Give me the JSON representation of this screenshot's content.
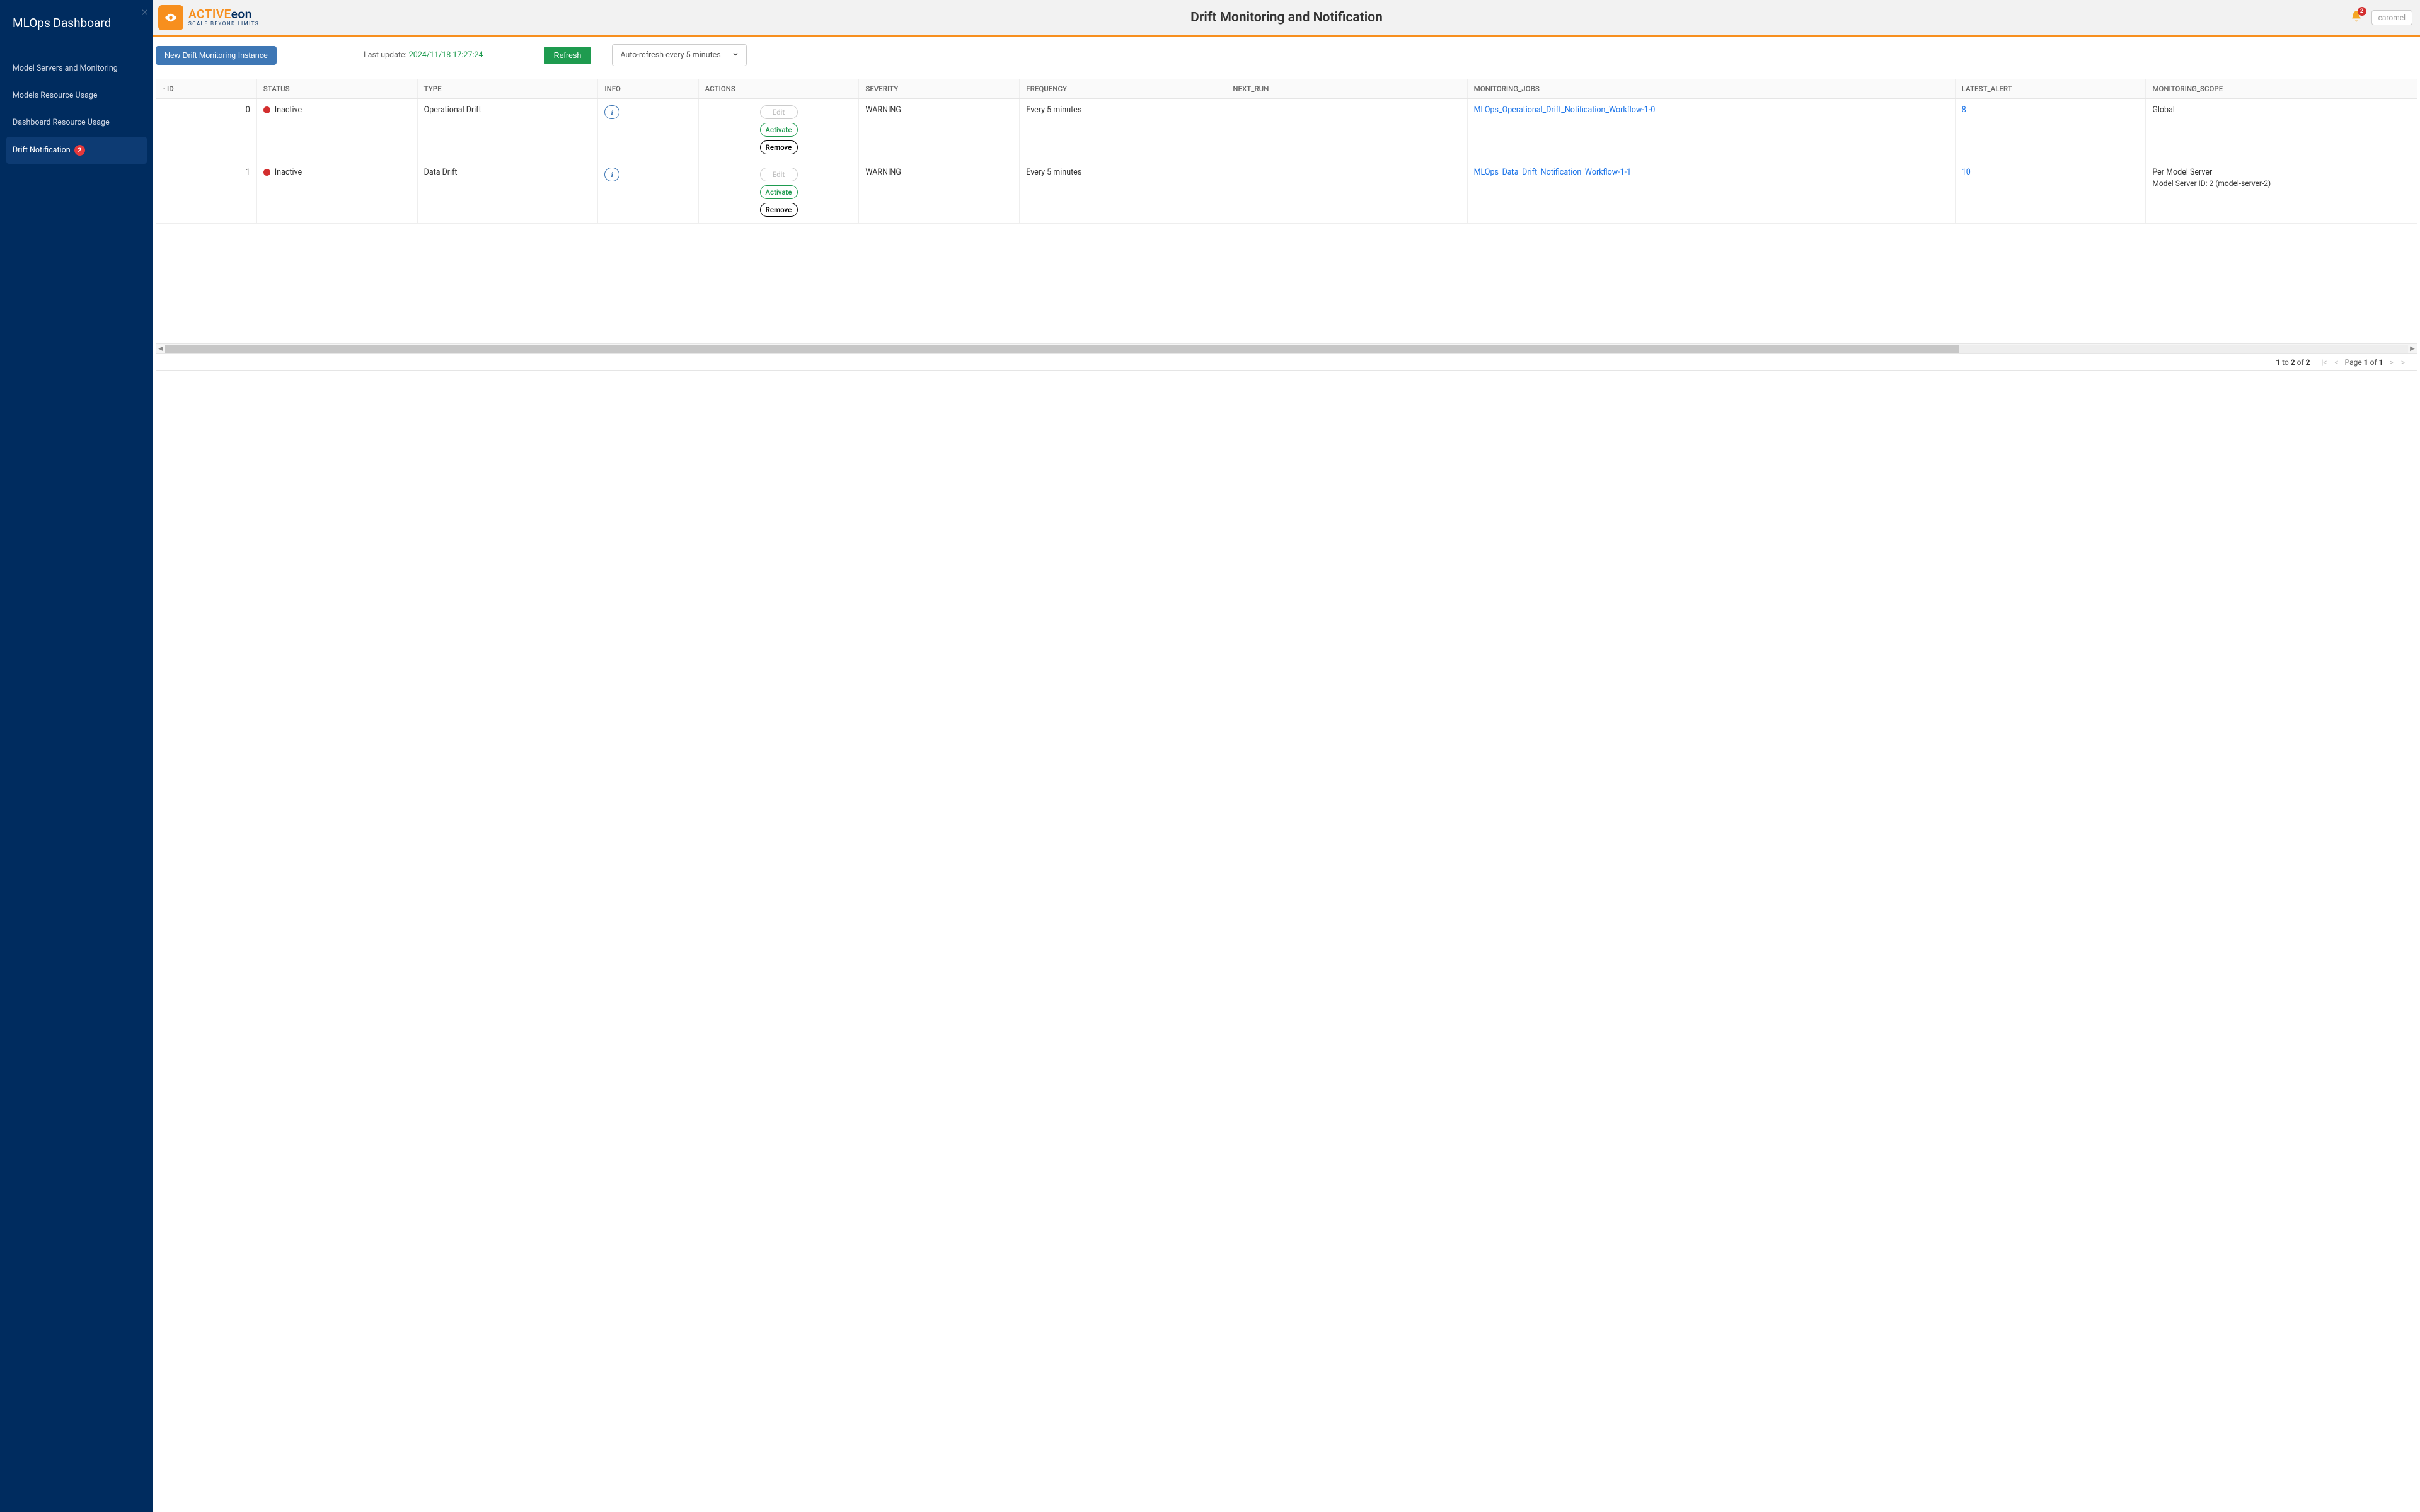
{
  "sidebar": {
    "title": "MLOps Dashboard",
    "items": [
      {
        "label": "Model Servers and Monitoring",
        "active": false
      },
      {
        "label": "Models Resource Usage",
        "active": false
      },
      {
        "label": "Dashboard Resource Usage",
        "active": false
      },
      {
        "label": "Drift Notification",
        "active": true,
        "badge": "2"
      }
    ]
  },
  "header": {
    "brand_main_1": "ACTIVE",
    "brand_main_2": "eon",
    "brand_tag": "SCALE BEYOND LIMITS",
    "title": "Drift Monitoring and Notification",
    "notif_count": "2",
    "user": "caromel"
  },
  "toolbar": {
    "new_btn": "New Drift Monitoring Instance",
    "last_update_label": "Last update: ",
    "last_update_ts": "2024/11/18 17:27:24",
    "refresh": "Refresh",
    "autorefresh": "Auto-refresh every 5 minutes"
  },
  "columns": {
    "id": "ID",
    "status": "STATUS",
    "type": "TYPE",
    "info": "INFO",
    "actions": "ACTIONS",
    "severity": "SEVERITY",
    "frequency": "FREQUENCY",
    "next_run": "NEXT_RUN",
    "jobs": "MONITORING_JOBS",
    "alert": "LATEST_ALERT",
    "scope": "MONITORING_SCOPE"
  },
  "actions_labels": {
    "edit": "Edit",
    "activate": "Activate",
    "remove": "Remove"
  },
  "rows": [
    {
      "id": "0",
      "status_label": "Inactive",
      "type": "Operational Drift",
      "severity": "WARNING",
      "frequency": "Every 5 minutes",
      "next_run": "",
      "job": "MLOps_Operational_Drift_Notification_Workflow-1-0",
      "alert": "8",
      "scope_line1": "Global",
      "scope_line2": ""
    },
    {
      "id": "1",
      "status_label": "Inactive",
      "type": "Data Drift",
      "severity": "WARNING",
      "frequency": "Every 5 minutes",
      "next_run": "",
      "job": "MLOps_Data_Drift_Notification_Workflow-1-1",
      "alert": "10",
      "scope_line1": "Per Model Server",
      "scope_line2": "Model Server ID: 2 (model-server-2)"
    }
  ],
  "pagination": {
    "from": "1",
    "to": "2",
    "total": "2",
    "page": "1",
    "pages": "1",
    "to_word": " to ",
    "of_word": " of ",
    "page_word": "Page "
  },
  "scroll": {
    "thumb_width_pct": "80"
  }
}
